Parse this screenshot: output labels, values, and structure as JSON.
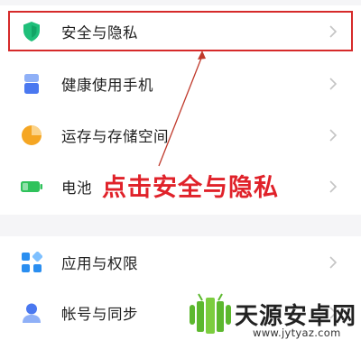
{
  "settings_list": {
    "items": [
      {
        "key": "security",
        "label": "安全与隐私",
        "icon": "shield-icon",
        "color": "#1fbf7a"
      },
      {
        "key": "health",
        "label": "健康使用手机",
        "icon": "hourglass-icon",
        "color": "#4a78f0"
      },
      {
        "key": "storage",
        "label": "运存与存储空间",
        "icon": "pie-chart-icon",
        "color": "#f5a623"
      },
      {
        "key": "battery",
        "label": "电池",
        "icon": "battery-icon",
        "color": "#2fc25b"
      },
      {
        "key": "apps",
        "label": "应用与权限",
        "icon": "apps-grid-icon",
        "color": "#2a8ef0"
      },
      {
        "key": "accounts",
        "label": "帐号与同步",
        "icon": "person-icon",
        "color": "#4a78f0"
      }
    ]
  },
  "annotation": {
    "text": "点击安全与隐私",
    "color": "#e0222a"
  },
  "watermark": {
    "title": "天源安卓网",
    "url": "www.jytyaz.com"
  }
}
